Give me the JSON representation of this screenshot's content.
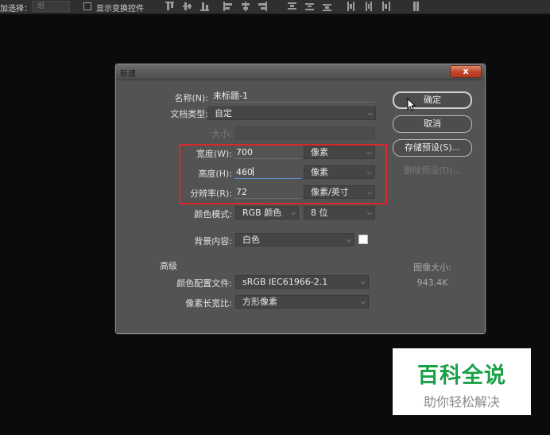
{
  "optbar": {
    "label": "加选择：",
    "combo_value": "组",
    "checkbox_label": "显示变换控件",
    "align_icons": [
      "align-top-icon",
      "align-vcenter-icon",
      "align-bottom-icon",
      "align-left-icon",
      "align-hcenter-icon",
      "align-right-icon",
      "distribute-top-icon",
      "distribute-vcenter-icon",
      "distribute-bottom-icon",
      "distribute-left-icon",
      "distribute-hcenter-icon",
      "distribute-right-icon",
      "auto-align-icon"
    ]
  },
  "dialog": {
    "title": "新建",
    "close_label": "x",
    "name_label": "名称(N):",
    "name_value": "未标题-1",
    "doctype_label": "文档类型:",
    "doctype_value": "自定",
    "size_label": "大小:",
    "size_value": "",
    "width_label": "宽度(W):",
    "width_value": "700",
    "width_unit": "像素",
    "height_label": "高度(H):",
    "height_value": "460",
    "height_unit": "像素",
    "resolution_label": "分辨率(R):",
    "resolution_value": "72",
    "resolution_unit": "像素/英寸",
    "colormode_label": "颜色模式:",
    "colormode_value": "RGB 颜色",
    "bitdepth_value": "8 位",
    "background_label": "背景内容:",
    "background_value": "白色",
    "background_swatch": "#ffffff",
    "advanced_label": "高级",
    "colorprofile_label": "颜色配置文件:",
    "colorprofile_value": "sRGB IEC61966-2.1",
    "pixelaspect_label": "像素长宽比:",
    "pixelaspect_value": "方形像素",
    "ok_label": "确定",
    "cancel_label": "取消",
    "save_preset_label": "存储预设(S)...",
    "delete_preset_label": "删除预设(D)...",
    "image_size_label": "图像大小:",
    "image_size_value": "943.4K",
    "highlight_color": "#e0262b"
  },
  "watermark": {
    "title": "百科全说",
    "subtitle": "助你轻松解决",
    "color": "#1aa147"
  }
}
